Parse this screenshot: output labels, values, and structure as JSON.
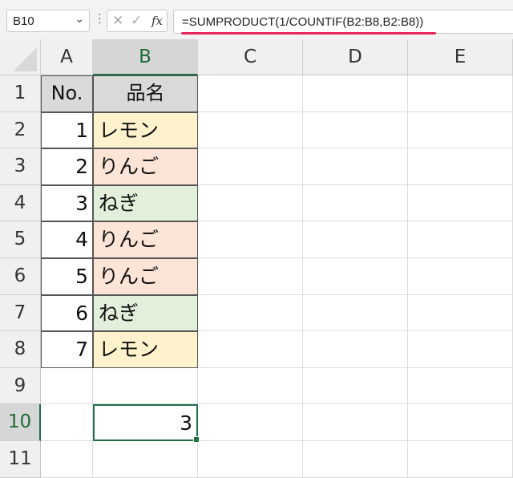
{
  "name_box": {
    "value": "B10"
  },
  "formula_bar": {
    "cancel_glyph": "✕",
    "enter_glyph": "✓",
    "fx_label": "fx",
    "formula": "=SUMPRODUCT(1/COUNTIF(B2:B8,B2:B8))"
  },
  "columns": [
    "A",
    "B",
    "C",
    "D",
    "E"
  ],
  "rows": [
    "1",
    "2",
    "3",
    "4",
    "5",
    "6",
    "7",
    "8",
    "9",
    "10",
    "11"
  ],
  "table": {
    "header_a": "No.",
    "header_b": "品名",
    "items": [
      {
        "no": "1",
        "name": "レモン",
        "color": "#fff2cc"
      },
      {
        "no": "2",
        "name": "りんご",
        "color": "#fce4d6"
      },
      {
        "no": "3",
        "name": "ねぎ",
        "color": "#e2efda"
      },
      {
        "no": "4",
        "name": "りんご",
        "color": "#fce4d6"
      },
      {
        "no": "5",
        "name": "りんご",
        "color": "#fce4d6"
      },
      {
        "no": "6",
        "name": "ねぎ",
        "color": "#e2efda"
      },
      {
        "no": "7",
        "name": "レモン",
        "color": "#fff2cc"
      }
    ]
  },
  "result_cell": {
    "address": "B10",
    "value": "3"
  },
  "colors": {
    "header_fill": "#d9d9d9",
    "selection": "#1e7145",
    "formula_underline": "#e8265a"
  }
}
